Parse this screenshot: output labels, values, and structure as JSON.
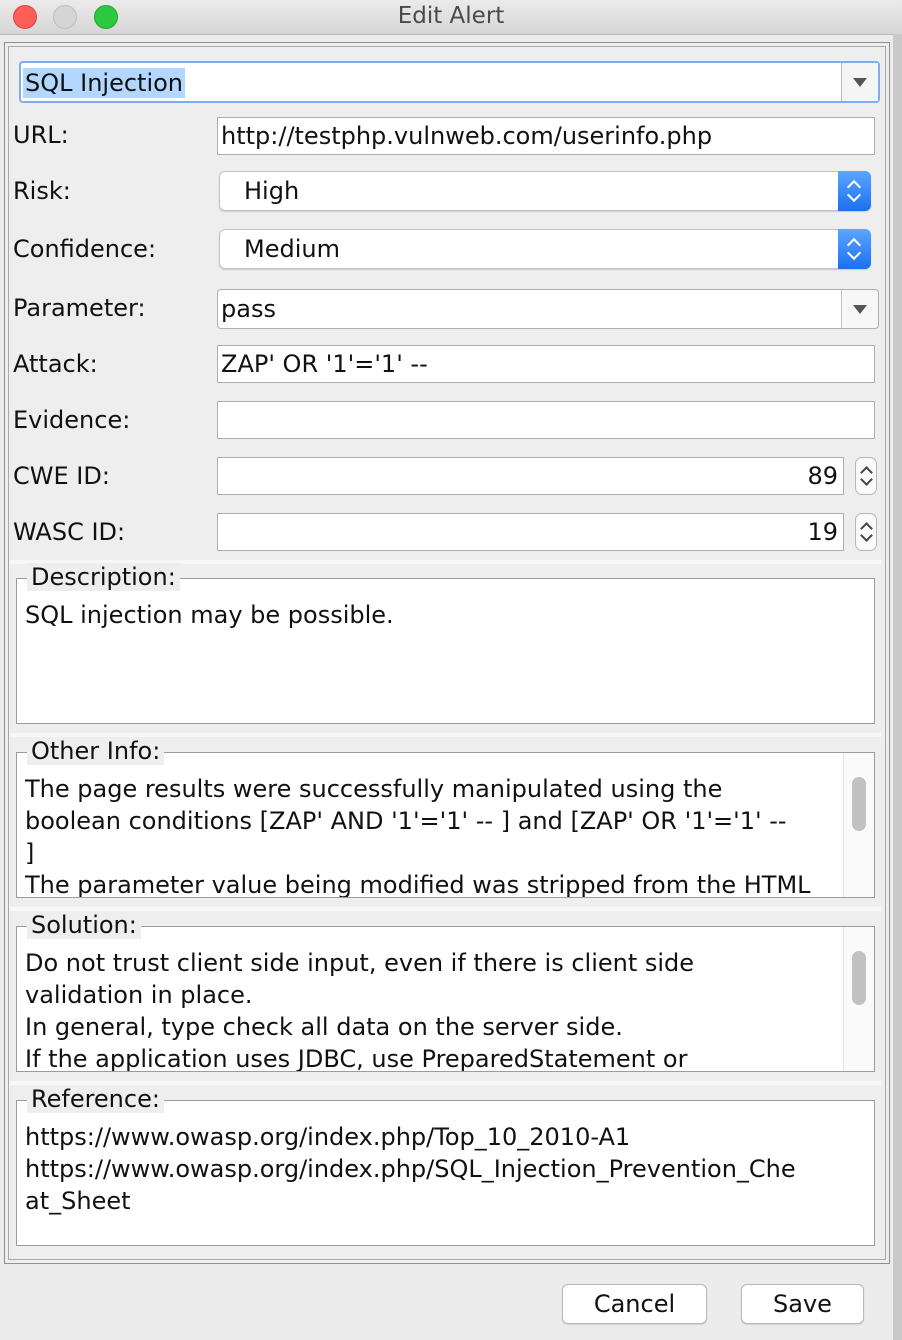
{
  "window": {
    "title": "Edit Alert"
  },
  "alert_name": "SQL Injection",
  "fields": {
    "url_label": "URL:",
    "url_value": "http://testphp.vulnweb.com/userinfo.php",
    "risk_label": "Risk:",
    "risk_value": "High",
    "confidence_label": "Confidence:",
    "confidence_value": "Medium",
    "parameter_label": "Parameter:",
    "parameter_value": "pass",
    "attack_label": "Attack:",
    "attack_value": "ZAP' OR '1'='1' --",
    "evidence_label": "Evidence:",
    "evidence_value": "",
    "cwe_label": "CWE ID:",
    "cwe_value": "89",
    "wasc_label": "WASC ID:",
    "wasc_value": "19"
  },
  "sections": {
    "description": {
      "title": "Description:",
      "text": "SQL injection may be possible."
    },
    "other_info": {
      "title": "Other Info:",
      "text": "The page results were successfully manipulated using the\nboolean conditions [ZAP' AND '1'='1' -- ] and [ZAP' OR '1'='1' --\n]\nThe parameter value being modified was stripped from the HTML"
    },
    "solution": {
      "title": "Solution:",
      "text": "Do not trust client side input, even if there is client side\nvalidation in place.\nIn general, type check all data on the server side.\nIf the application uses JDBC, use PreparedStatement or"
    },
    "reference": {
      "title": "Reference:",
      "text": "https://www.owasp.org/index.php/Top_10_2010-A1\nhttps://www.owasp.org/index.php/SQL_Injection_Prevention_Che\nat_Sheet"
    }
  },
  "buttons": {
    "cancel": "Cancel",
    "save": "Save"
  },
  "colors": {
    "selection": "#b3d7ff",
    "focus": "#7eaef0",
    "stepper": "#1c6ff0"
  }
}
